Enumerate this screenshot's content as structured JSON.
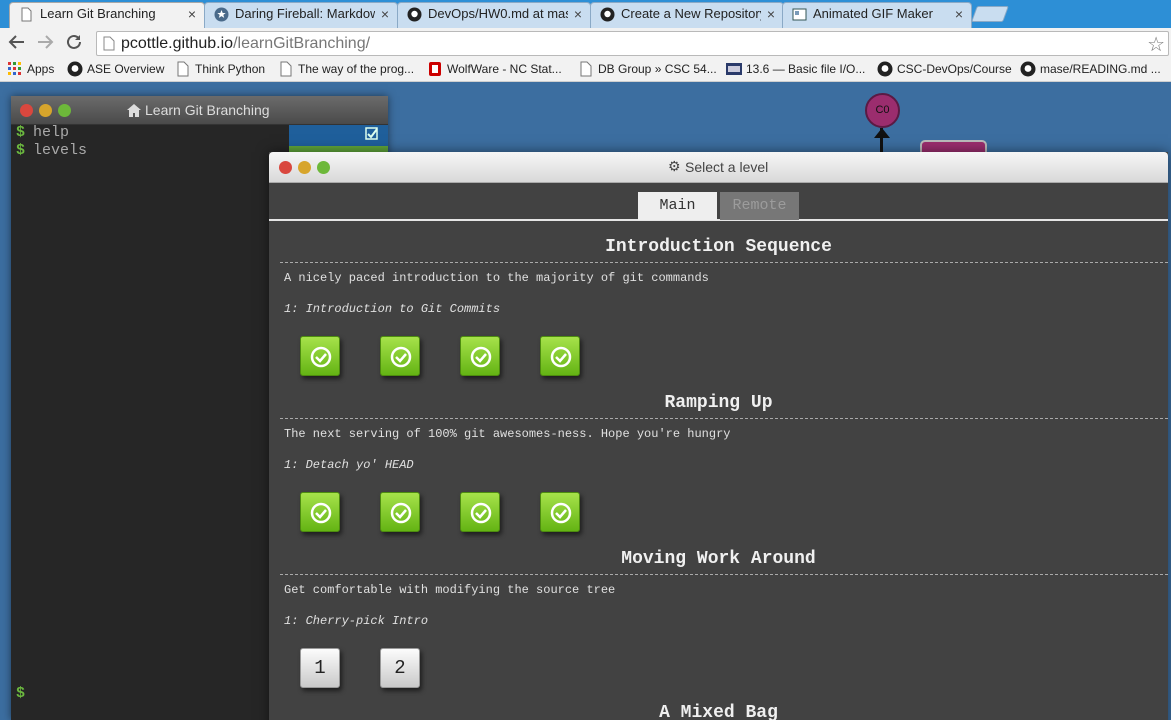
{
  "browser": {
    "tabs": [
      {
        "label": "Learn Git Branching",
        "close": "×"
      },
      {
        "label": "Daring Fireball: Markdown",
        "close": "×"
      },
      {
        "label": "DevOps/HW0.md at maste",
        "close": "×"
      },
      {
        "label": "Create a New Repository",
        "close": "×"
      },
      {
        "label": "Animated GIF Maker",
        "close": "×"
      }
    ],
    "url_host": "pcottle.github.io",
    "url_path": "/learnGitBranching/",
    "bookmarks": [
      {
        "label": "Apps",
        "icon": "apps-grid-icon"
      },
      {
        "label": "ASE Overview",
        "icon": "github-icon"
      },
      {
        "label": "Think Python",
        "icon": "page-icon"
      },
      {
        "label": "The way of the prog...",
        "icon": "page-icon"
      },
      {
        "label": "WolfWare - NC Stat...",
        "icon": "ncsu-icon"
      },
      {
        "label": "DB Group » CSC 54...",
        "icon": "page-icon"
      },
      {
        "label": "13.6 — Basic file I/O...",
        "icon": "cpp-icon"
      },
      {
        "label": "CSC-DevOps/Course",
        "icon": "github-icon"
      },
      {
        "label": "mase/READING.md ...",
        "icon": "github-icon"
      }
    ]
  },
  "terminal": {
    "title": "Learn Git Branching",
    "prompt": "$",
    "commands": [
      "help",
      "levels"
    ]
  },
  "graph": {
    "node_label": "C0"
  },
  "dialog": {
    "title": "Select a level",
    "tabs": [
      "Main",
      "Remote"
    ],
    "sequences": [
      {
        "title": "Introduction Sequence",
        "description": "A nicely paced introduction to the majority of git commands",
        "level": "1: Introduction to Git Commits",
        "levels": [
          {
            "done": true
          },
          {
            "done": true
          },
          {
            "done": true
          },
          {
            "done": true
          }
        ]
      },
      {
        "title": "Ramping Up",
        "description": "The next serving of 100% git awesomes-ness. Hope you're hungry",
        "level": "1: Detach yo' HEAD",
        "levels": [
          {
            "done": true
          },
          {
            "done": true
          },
          {
            "done": true
          },
          {
            "done": true
          }
        ]
      },
      {
        "title": "Moving Work Around",
        "description": "Get comfortable with modifying the source tree",
        "level": "1: Cherry-pick Intro",
        "levels": [
          {
            "done": false,
            "label": "1"
          },
          {
            "done": false,
            "label": "2"
          }
        ]
      },
      {
        "title": "A Mixed Bag"
      }
    ]
  },
  "colors": {
    "chrome_tabstrip": "#2d8fd6",
    "app_background": "#3c6ea0",
    "dialog_background": "#424242",
    "level_done": "#7cc425",
    "prompt_green": "#6bb83f"
  }
}
